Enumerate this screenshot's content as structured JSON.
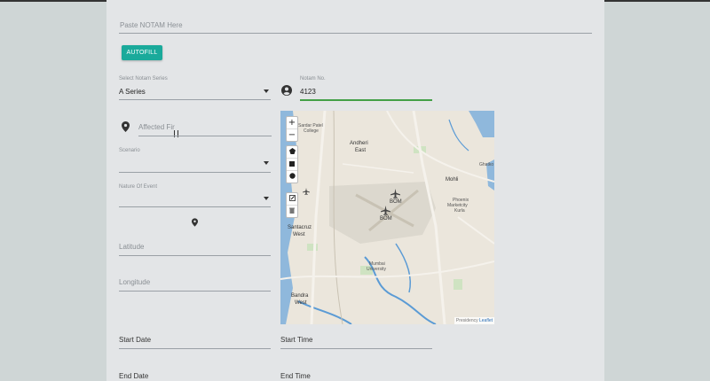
{
  "notam_paste": {
    "placeholder": "Paste NOTAM Here"
  },
  "autofill_label": "AUTOFILL",
  "series": {
    "label": "Select Notam Series",
    "value": "A Series"
  },
  "notam_no": {
    "label": "Notam No.",
    "value": "4123"
  },
  "affected_fir": {
    "placeholder": "Affected Fir"
  },
  "scenario": {
    "label": "Scenario",
    "value": ""
  },
  "nature_of_event": {
    "label": "Nature Of Event",
    "value": ""
  },
  "latitude": {
    "placeholder": "Latitude"
  },
  "longitude": {
    "placeholder": "Longitude"
  },
  "start_date": {
    "placeholder": "Start Date"
  },
  "start_time": {
    "placeholder": "Start Time"
  },
  "end_date": {
    "placeholder": "End Date"
  },
  "end_time": {
    "placeholder": "End Time"
  },
  "map": {
    "zoom_in": "+",
    "zoom_out": "−",
    "attribution": "Leaflet",
    "attribution_prefix": "Presidency",
    "labels": {
      "bom1": "BOM",
      "bom2": "BOM",
      "andheri": "Andheri",
      "east": "East",
      "santacruz": "Santacruz",
      "west": "West",
      "mumbai_uni": "Mumbai",
      "university": "University",
      "bandra": "Bandra",
      "bandra_west": "West",
      "phoenix": "Phoenix",
      "marketcity": "Marketcity",
      "kurla": "Kurla",
      "mohli": "Mohli",
      "ghatko": "Ghatko",
      "patel_college": "Sardar Patel",
      "college": "College"
    }
  },
  "colors": {
    "accent": "#1aaa9b",
    "active_underline": "#43a047",
    "water": "#5b9bd5"
  }
}
